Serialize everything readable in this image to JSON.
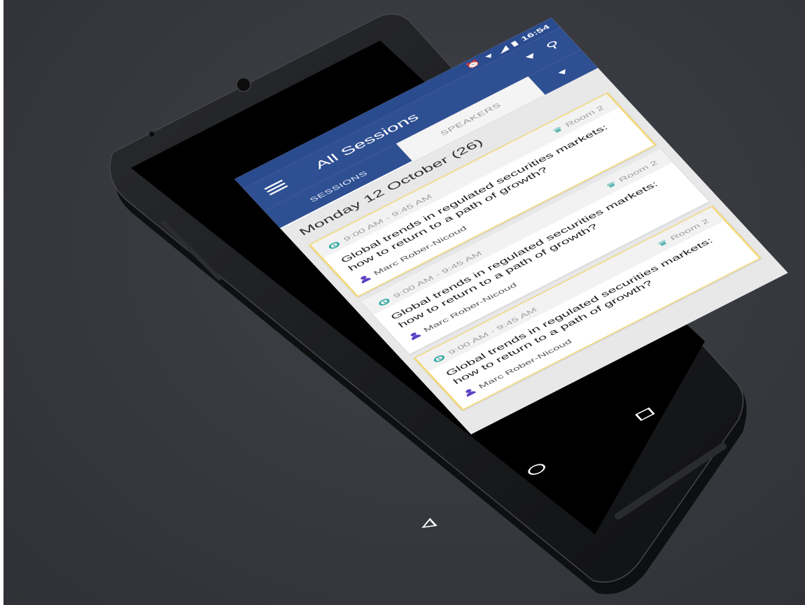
{
  "status_bar": {
    "time": "16:54",
    "icons": [
      "alarm-icon",
      "wifi-icon",
      "signal-icon",
      "battery-icon"
    ]
  },
  "app_bar": {
    "title": "All Sessions",
    "actions": [
      "dropdown-arrow-icon",
      "search-icon"
    ]
  },
  "tabs": [
    {
      "label": "SESSIONS",
      "selected": true
    },
    {
      "label": "SPEAKERS",
      "selected": false
    }
  ],
  "day_header": "Monday 12 October (26)",
  "sessions": [
    {
      "time": "9:00 AM - 9:45 AM",
      "room": "Room 2",
      "title": "Global trends in regulated securities markets: how to return to a path of growth?",
      "speaker": "Marc Rober-Nicoud",
      "highlighted": true
    },
    {
      "time": "9:00 AM - 9:45 AM",
      "room": "Room 2",
      "title": "Global trends in regulated securities markets: how to return to a path of growth?",
      "speaker": "Marc Rober-Nicoud",
      "highlighted": false
    },
    {
      "time": "9:00 AM - 9:45 AM",
      "room": "Room 2",
      "title": "Global trends in regulated securities markets: how to return to a path of growth?",
      "speaker": "Marc Rober-Nicoud",
      "highlighted": true
    }
  ],
  "nav_bar": [
    "back-icon",
    "home-icon",
    "recents-icon"
  ],
  "colors": {
    "primary": "#2f4f93",
    "highlight_border": "#f2d777",
    "accent_teal": "#2aa5a0",
    "speaker_purple": "#5b3fc4",
    "backdrop": "#36383e"
  }
}
